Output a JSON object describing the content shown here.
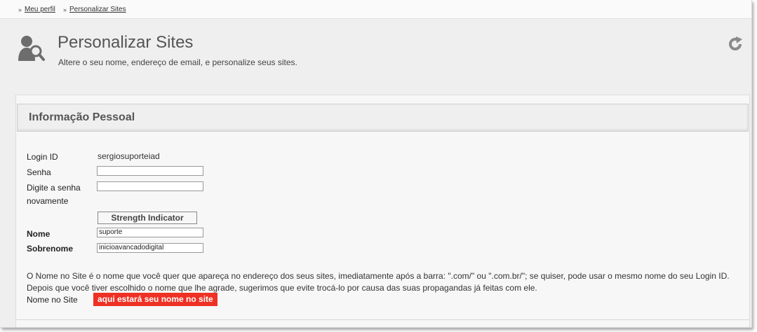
{
  "breadcrumb": {
    "separator": "››",
    "items": [
      {
        "label": "Meu perfil"
      },
      {
        "label": "Personalizar Sites"
      }
    ]
  },
  "header": {
    "title": "Personalizar Sites",
    "subtitle": "Altere o seu nome, endereço de email, e personalize seus sites.",
    "icons": {
      "page": "user-search-icon",
      "refresh": "refresh-icon"
    }
  },
  "section": {
    "title": "Informação Pessoal"
  },
  "form": {
    "login_label": "Login ID",
    "login_value": "sergiosuporteiad",
    "password_label": "Senha",
    "password_value": "",
    "confirm_label_line1": "Digite a senha",
    "confirm_label_line2": "novamente",
    "confirm_value": "",
    "strength_label": "Strength Indicator",
    "first_name_label": "Nome",
    "first_name_value": "suporte",
    "last_name_label": "Sobrenome",
    "last_name_value": "inicioavancadodigital",
    "site_name_help_line1": "O Nome no Site é o nome que você quer que apareça no endereço dos seus sites, imediatamente após a barra: \".com/\" ou \".com.br/\"; se quiser, pode usar o mesmo nome do seu Login ID.",
    "site_name_help_line2": "Depois que você tiver escolhido o nome que lhe agrade, sugerimos que evite trocá-lo por causa das suas propagandas já feitas com ele.",
    "site_name_label": "Nome no Site",
    "site_name_value": "aqui estará seu nome no site"
  },
  "colors": {
    "accent_red": "#ee3124",
    "icon_gray": "#6d6d6d"
  }
}
